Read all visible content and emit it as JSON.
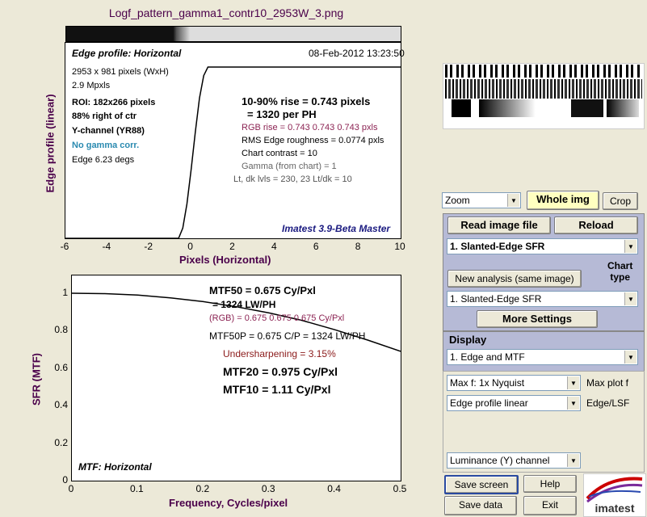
{
  "title": "Logf_pattern_gamma1_contr10_2953W_3.png",
  "edge_plot": {
    "heading": "Edge profile: Horizontal",
    "date": "08-Feb-2012 13:23:50",
    "ylabel": "Edge profile (linear)",
    "xlabel": "Pixels (Horizontal)",
    "xticks": [
      "-6",
      "-4",
      "-2",
      "0",
      "2",
      "4",
      "6",
      "8",
      "10"
    ],
    "info": {
      "pixels": "2953 x 981 pixels (WxH)",
      "mpxls": "2.9 Mpxls",
      "roi": "ROI:  182x266 pixels",
      "right_of_ctr": "88% right of ctr",
      "channel": "Y-channel  (YR88)",
      "gamma": "No gamma corr.",
      "edge_angle": "Edge 6.23 degs"
    },
    "results": {
      "rise": "10-90% rise = 0.743 pixels",
      "per_ph": "= 1320 per PH",
      "rgb_rise": "RGB rise = 0.743  0.743  0.743 pxls",
      "rms": "RMS Edge roughness = 0.0774 pxls",
      "contrast": "Chart contrast = 10",
      "gamma_chart": "Gamma (from chart) = 1",
      "levels": "Lt, dk lvls = 230, 23   Lt/dk = 10"
    },
    "version": "Imatest 3.9-Beta Master"
  },
  "mtf_plot": {
    "heading": "MTF: Horizontal",
    "ylabel": "SFR (MTF)",
    "xlabel": "Frequency, Cycles/pixel",
    "xticks": [
      "0",
      "0.1",
      "0.2",
      "0.3",
      "0.4",
      "0.5"
    ],
    "yticks": [
      "1",
      "0.8",
      "0.6",
      "0.4",
      "0.2",
      "0"
    ],
    "results": {
      "mtf50": "MTF50 = 0.675 Cy/Pxl",
      "lwph": "= 1324 LW/PH",
      "rgb": "(RGB) = 0.675  0.675  0.675 Cy/Pxl",
      "mtf50p": "MTF50P = 0.675 C/P = 1324 LW/PH",
      "undersharp": "Undersharpening = 3.15%",
      "mtf20": "MTF20 = 0.975 Cy/Pxl",
      "mtf10": "MTF10 = 1.11 Cy/Pxl"
    }
  },
  "chart_data": [
    {
      "type": "line",
      "title": "Edge profile: Horizontal",
      "xlabel": "Pixels (Horizontal)",
      "ylabel": "Edge profile (linear)",
      "xlim": [
        -6,
        10
      ],
      "ylim": [
        0,
        1
      ],
      "series": [
        {
          "x": [
            -6,
            -0.6,
            -0.4,
            -0.2,
            0,
            0.2,
            0.4,
            0.6,
            0.8,
            10
          ],
          "y": [
            0,
            0,
            0.06,
            0.2,
            0.4,
            0.62,
            0.82,
            0.95,
            1,
            1
          ]
        }
      ]
    },
    {
      "type": "line",
      "title": "MTF: Horizontal",
      "xlabel": "Frequency, Cycles/pixel",
      "ylabel": "SFR (MTF)",
      "xlim": [
        0,
        0.5
      ],
      "ylim": [
        0,
        1
      ],
      "series": [
        {
          "x": [
            0,
            0.05,
            0.1,
            0.15,
            0.2,
            0.25,
            0.3,
            0.35,
            0.4,
            0.45,
            0.5
          ],
          "y": [
            1,
            0.998,
            0.99,
            0.975,
            0.955,
            0.928,
            0.895,
            0.855,
            0.805,
            0.75,
            0.69
          ]
        }
      ]
    }
  ],
  "controls": {
    "zoom": "Zoom",
    "whole_img": "Whole img",
    "crop": "Crop",
    "read_image": "Read image file",
    "reload": "Reload",
    "analysis_select": "1. Slanted-Edge SFR",
    "chart_type_label": "Chart\ntype",
    "new_analysis": "New analysis (same image)",
    "chart_type_select": "1. Slanted-Edge SFR",
    "more_settings": "More Settings",
    "display_label": "Display",
    "display_select": "1.  Edge and MTF",
    "maxf_select": "Max f:    1x Nyquist",
    "maxf_label": "Max plot f",
    "edge_select": "Edge profile linear",
    "edge_label": "Edge/LSF",
    "channel_select": "Luminance (Y) channel",
    "save_screen": "Save screen",
    "help": "Help",
    "save_data": "Save data",
    "exit": "Exit",
    "logo": "imatest"
  }
}
